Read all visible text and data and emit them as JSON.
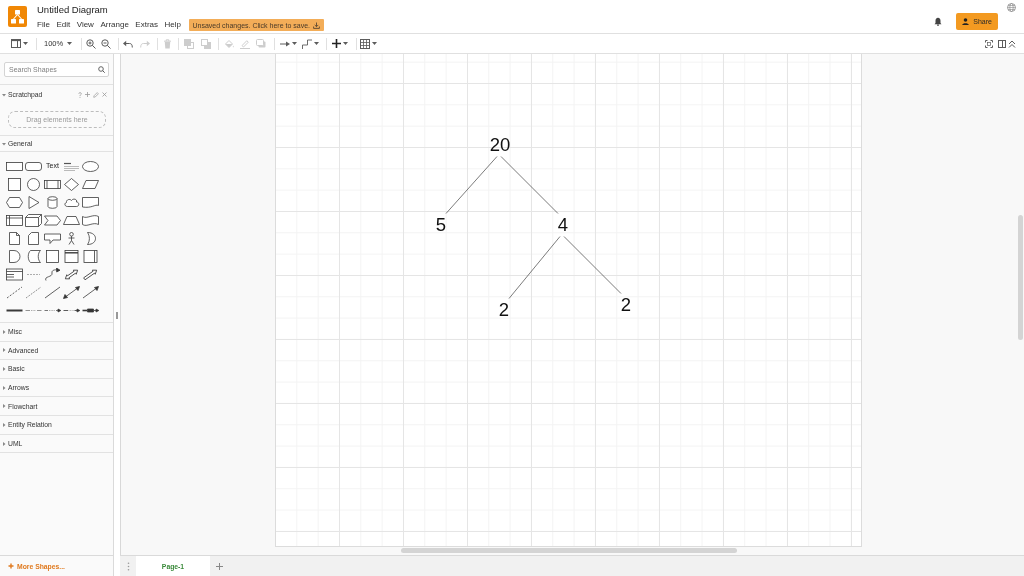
{
  "header": {
    "title": "Untitled Diagram",
    "menu": [
      "File",
      "Edit",
      "View",
      "Arrange",
      "Extras",
      "Help"
    ],
    "save_notice": "Unsaved changes. Click here to save.",
    "share_button": "Share"
  },
  "toolbar": {
    "zoom": "100%",
    "buttons": [
      {
        "disabled": false
      },
      {
        "disabled": false
      },
      {
        "disabled": false
      },
      {
        "disabled": false
      },
      {
        "disabled": true
      },
      {
        "disabled": true
      },
      {
        "disabled": true
      },
      {
        "disabled": true
      },
      {
        "disabled": true
      },
      {
        "disabled": true
      },
      {
        "disabled": true
      },
      {
        "disabled": false
      },
      {
        "disabled": false
      },
      {
        "disabled": false
      },
      {
        "disabled": false
      },
      {
        "disabled": false
      },
      {
        "disabled": false
      },
      {
        "disabled": false
      }
    ]
  },
  "sidebar": {
    "search": {
      "placeholder": "Search Shapes"
    },
    "sections": [
      {
        "kind": "scratchpad",
        "title": "Scratchpad",
        "expanded": true,
        "drop_hint": "Drag elements here"
      },
      {
        "kind": "palette",
        "title": "General",
        "expanded": true,
        "text_sample": "Text"
      },
      {
        "kind": "category",
        "title": "Misc",
        "expanded": false
      },
      {
        "kind": "category",
        "title": "Advanced",
        "expanded": false
      },
      {
        "kind": "category",
        "title": "Basic",
        "expanded": false
      },
      {
        "kind": "category",
        "title": "Arrows",
        "expanded": false
      },
      {
        "kind": "category",
        "title": "Flowchart",
        "expanded": false
      },
      {
        "kind": "category",
        "title": "Entity Relation",
        "expanded": false
      },
      {
        "kind": "category",
        "title": "UML",
        "expanded": false
      }
    ],
    "more_shapes": "More Shapes..."
  },
  "diagram": {
    "tree": {
      "label": "20",
      "children": [
        {
          "label": "5"
        },
        {
          "label": "4",
          "children": [
            {
              "label": "2"
            },
            {
              "label": "2"
            }
          ]
        }
      ]
    }
  },
  "page_tabs": [
    {
      "label": "Page-1",
      "selected": true
    }
  ]
}
